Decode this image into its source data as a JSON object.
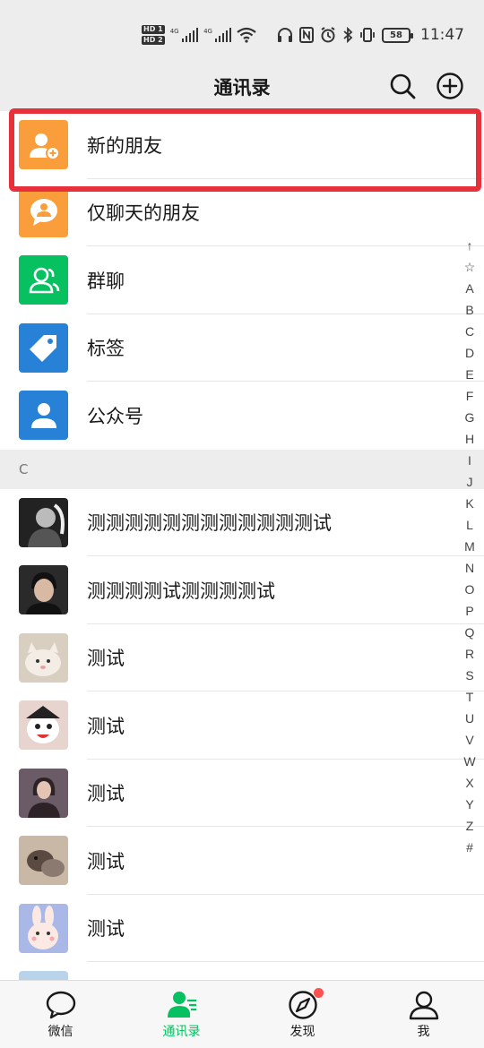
{
  "status_bar": {
    "hd1": "HD 1",
    "hd2": "HD 2",
    "net1": "4G",
    "net2": "4G",
    "battery": "58",
    "time": "11:47"
  },
  "header": {
    "title": "通讯录",
    "icons": [
      "search-icon",
      "add-circle-icon"
    ]
  },
  "functions": [
    {
      "label": "新的朋友",
      "icon": "new-friend-icon",
      "color": "#fa9d3b"
    },
    {
      "label": "仅聊天的朋友",
      "icon": "chat-only-icon",
      "color": "#fa9d3b"
    },
    {
      "label": "群聊",
      "icon": "group-chat-icon",
      "color": "#07c160"
    },
    {
      "label": "标签",
      "icon": "tag-icon",
      "color": "#2782d7"
    },
    {
      "label": "公众号",
      "icon": "official-account-icon",
      "color": "#2782d7"
    }
  ],
  "section_letter": "C",
  "contacts": [
    {
      "name": "测测测测测测测测测测测测试",
      "avatar": "avatar-dark-portrait"
    },
    {
      "name": "测测测测试测测测测试",
      "avatar": "avatar-man-portrait"
    },
    {
      "name": "测试",
      "avatar": "avatar-cat"
    },
    {
      "name": "测试",
      "avatar": "avatar-cartoon"
    },
    {
      "name": "测试",
      "avatar": "avatar-girl"
    },
    {
      "name": "测试",
      "avatar": "avatar-animal"
    },
    {
      "name": "测试",
      "avatar": "avatar-bunny"
    }
  ],
  "index_letters": [
    "↑",
    "☆",
    "A",
    "B",
    "C",
    "D",
    "E",
    "F",
    "G",
    "H",
    "I",
    "J",
    "K",
    "L",
    "M",
    "N",
    "O",
    "P",
    "Q",
    "R",
    "S",
    "T",
    "U",
    "V",
    "W",
    "X",
    "Y",
    "Z",
    "#"
  ],
  "tabs": [
    {
      "label": "微信",
      "icon": "chat-bubble-icon",
      "active": false
    },
    {
      "label": "通讯录",
      "icon": "contacts-icon",
      "active": true
    },
    {
      "label": "发现",
      "icon": "compass-icon",
      "active": false
    },
    {
      "label": "我",
      "icon": "person-icon",
      "active": false
    }
  ],
  "colors": {
    "accent": "#07c160",
    "highlight": "#e8303a",
    "badge": "#fa5151"
  }
}
